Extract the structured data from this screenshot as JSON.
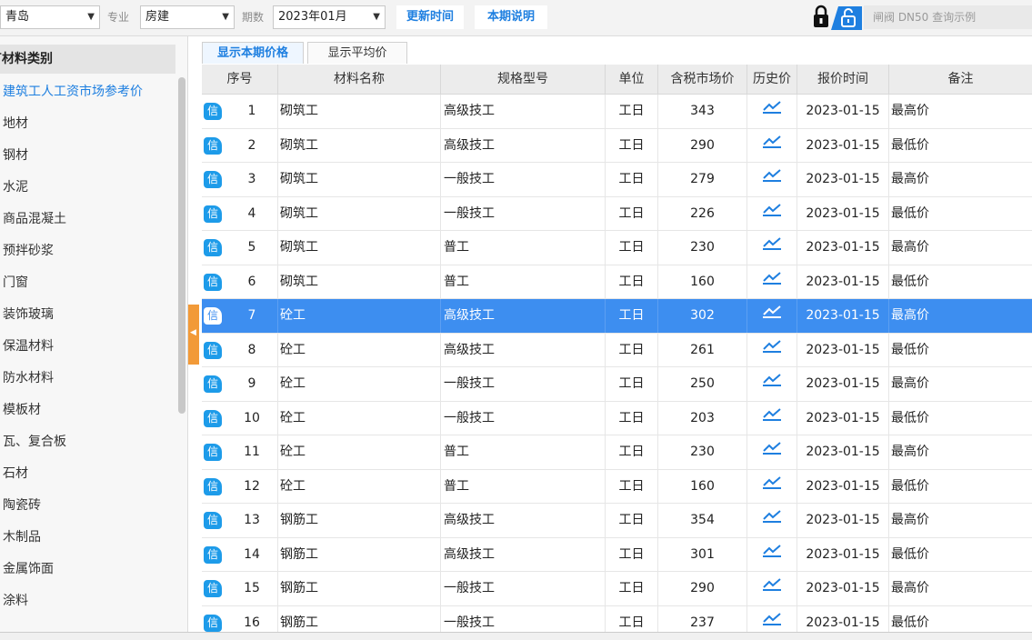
{
  "toolbar": {
    "region": "青岛",
    "major_label": "专业",
    "major": "房建",
    "period_label": "期数",
    "period": "2023年01月",
    "update_time_btn": "更新时间",
    "period_note_btn": "本期说明",
    "search_placeholder": "闸阀 DN50 查询示例",
    "colors": {
      "accent": "#1e7fe0",
      "selected_row": "#3d8ef0",
      "badge": "#1d9be9",
      "collapse_handle": "#f29a38"
    }
  },
  "sidebar": {
    "header": "有材料类别",
    "items": [
      "建筑工人工资市场参考价",
      "地材",
      "钢材",
      "水泥",
      "商品混凝土",
      "预拌砂浆",
      "门窗",
      "装饰玻璃",
      "保温材料",
      "防水材料",
      "模板材",
      "瓦、复合板",
      "石材",
      "陶瓷砖",
      "木制品",
      "金属饰面",
      "涂料"
    ]
  },
  "tabs": [
    "显示本期价格",
    "显示平均价"
  ],
  "table": {
    "columns": [
      "序号",
      "材料名称",
      "规格型号",
      "单位",
      "含税市场价",
      "历史价",
      "报价时间",
      "备注"
    ],
    "badge": "信",
    "selected_index": 6,
    "rows": [
      {
        "seq": "1",
        "name": "砌筑工",
        "spec": "高级技工",
        "unit": "工日",
        "price": "343",
        "date": "2023-01-15",
        "note": "最高价"
      },
      {
        "seq": "2",
        "name": "砌筑工",
        "spec": "高级技工",
        "unit": "工日",
        "price": "290",
        "date": "2023-01-15",
        "note": "最低价"
      },
      {
        "seq": "3",
        "name": "砌筑工",
        "spec": "一般技工",
        "unit": "工日",
        "price": "279",
        "date": "2023-01-15",
        "note": "最高价"
      },
      {
        "seq": "4",
        "name": "砌筑工",
        "spec": "一般技工",
        "unit": "工日",
        "price": "226",
        "date": "2023-01-15",
        "note": "最低价"
      },
      {
        "seq": "5",
        "name": "砌筑工",
        "spec": "普工",
        "unit": "工日",
        "price": "230",
        "date": "2023-01-15",
        "note": "最高价"
      },
      {
        "seq": "6",
        "name": "砌筑工",
        "spec": "普工",
        "unit": "工日",
        "price": "160",
        "date": "2023-01-15",
        "note": "最低价"
      },
      {
        "seq": "7",
        "name": "砼工",
        "spec": "高级技工",
        "unit": "工日",
        "price": "302",
        "date": "2023-01-15",
        "note": "最高价"
      },
      {
        "seq": "8",
        "name": "砼工",
        "spec": "高级技工",
        "unit": "工日",
        "price": "261",
        "date": "2023-01-15",
        "note": "最低价"
      },
      {
        "seq": "9",
        "name": "砼工",
        "spec": "一般技工",
        "unit": "工日",
        "price": "250",
        "date": "2023-01-15",
        "note": "最高价"
      },
      {
        "seq": "10",
        "name": "砼工",
        "spec": "一般技工",
        "unit": "工日",
        "price": "203",
        "date": "2023-01-15",
        "note": "最低价"
      },
      {
        "seq": "11",
        "name": "砼工",
        "spec": "普工",
        "unit": "工日",
        "price": "230",
        "date": "2023-01-15",
        "note": "最高价"
      },
      {
        "seq": "12",
        "name": "砼工",
        "spec": "普工",
        "unit": "工日",
        "price": "160",
        "date": "2023-01-15",
        "note": "最低价"
      },
      {
        "seq": "13",
        "name": "钢筋工",
        "spec": "高级技工",
        "unit": "工日",
        "price": "354",
        "date": "2023-01-15",
        "note": "最高价"
      },
      {
        "seq": "14",
        "name": "钢筋工",
        "spec": "高级技工",
        "unit": "工日",
        "price": "301",
        "date": "2023-01-15",
        "note": "最低价"
      },
      {
        "seq": "15",
        "name": "钢筋工",
        "spec": "一般技工",
        "unit": "工日",
        "price": "290",
        "date": "2023-01-15",
        "note": "最高价"
      },
      {
        "seq": "16",
        "name": "钢筋工",
        "spec": "一般技工",
        "unit": "工日",
        "price": "237",
        "date": "2023-01-15",
        "note": "最低价"
      }
    ]
  }
}
